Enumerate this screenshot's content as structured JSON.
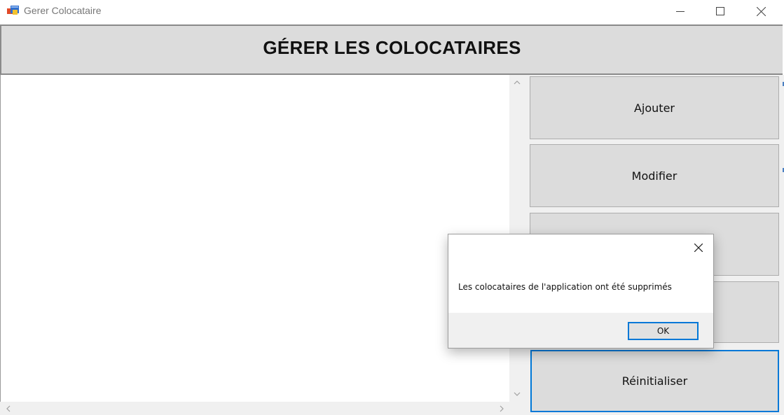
{
  "window": {
    "title": "Gerer Colocataire",
    "icon": "winforms-app-icon",
    "controls": [
      "minimize-icon",
      "maximize-icon",
      "close-icon"
    ]
  },
  "header": {
    "title": "GÉRER LES COLOCATAIRES"
  },
  "list": {
    "items": []
  },
  "buttons": {
    "ajouter": "Ajouter",
    "modifier": "Modifier",
    "reinitialiser": "Réinitialiser"
  },
  "dialog": {
    "message": "Les colocataires de l'application ont été supprimés",
    "ok_label": "OK"
  },
  "colors": {
    "header_bg": "#dcdcdc",
    "button_bg": "#dcdcdc",
    "focus_accent": "#0078d7",
    "panel_bg": "#f0f0f0"
  }
}
